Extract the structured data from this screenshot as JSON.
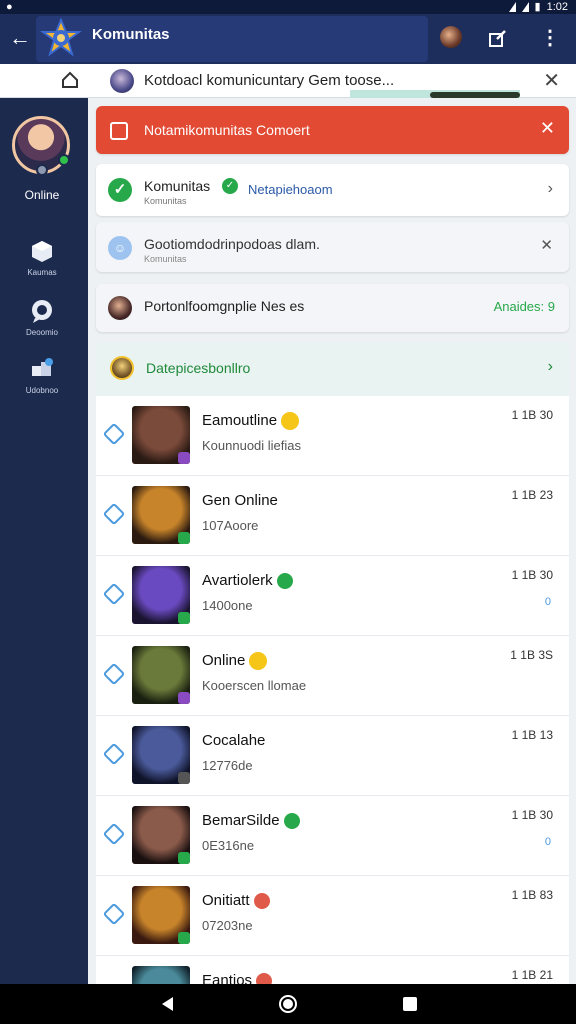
{
  "status_bar": {
    "time": "1:02"
  },
  "app_bar": {
    "title": "Komunitas"
  },
  "search": {
    "text": "Kotdoacl  komunicuntary Gem toose..."
  },
  "sidebar": {
    "online_label": "Online",
    "items": [
      {
        "label": "Kaumas",
        "icon": "box-icon"
      },
      {
        "label": "Deoomio",
        "icon": "chat-bubble-icon"
      },
      {
        "label": "Udobnoo",
        "icon": "group-icon"
      }
    ]
  },
  "alert": {
    "text": "Notamikomunitas Comoert"
  },
  "rows": {
    "row1": {
      "title": "Komunitas",
      "subtitle": "Komunitas",
      "link": "Netapiehoaom"
    },
    "row2": {
      "title": "Gootiomdodrinpodoas dlam.",
      "subtitle": "Komunitas"
    },
    "row3": {
      "title": "Portonlfoomgnplie Nes es",
      "action": "Anaides: 9"
    }
  },
  "section": {
    "title": "Datepicesbonllro"
  },
  "list": [
    {
      "name": "Eamoutline",
      "sub": "Kounnuodi liefias",
      "time": "1 1B 30",
      "tail": "",
      "badge": "emoji",
      "thumb": [
        "#7a4a3a",
        "#2a1a14"
      ],
      "tb": "#8a4ac0"
    },
    {
      "name": "Gen Online",
      "sub": "107Aoore",
      "time": "1 1B 23",
      "tail": "",
      "badge": "",
      "thumb": [
        "#c8842a",
        "#2a1a10"
      ],
      "tb": "#27a84a"
    },
    {
      "name": "Avartiolerk",
      "sub": "1400one",
      "time": "1 1B 30",
      "tail": "0",
      "badge": "green",
      "thumb": [
        "#6a4ac0",
        "#1a1430"
      ],
      "tb": "#27a84a"
    },
    {
      "name": "Online",
      "sub": "Kooerscen llomae",
      "time": "1 1B 3S",
      "tail": "",
      "badge": "emoji",
      "thumb": [
        "#6a7a3a",
        "#1a2010"
      ],
      "tb": "#8a4ac0"
    },
    {
      "name": "Cocalahe",
      "sub": "12776de",
      "time": "1 1B 13",
      "tail": "",
      "badge": "",
      "thumb": [
        "#4a5a9a",
        "#10142a"
      ],
      "tb": "#555555"
    },
    {
      "name": "BemarSilde",
      "sub": "0E316ne",
      "time": "1 1B 30",
      "tail": "0",
      "badge": "green",
      "thumb": [
        "#8a5a4a",
        "#1a1010"
      ],
      "tb": "#27a84a"
    },
    {
      "name": "Onitiatt",
      "sub": "07203ne",
      "time": "1 1B 83",
      "tail": "",
      "badge": "red",
      "thumb": [
        "#c8842a",
        "#3a1a10"
      ],
      "tb": "#27a84a"
    },
    {
      "name": "Eantios",
      "sub": "",
      "time": "1 1B 21",
      "tail": "",
      "badge": "red",
      "thumb": [
        "#4a8a9a",
        "#10202a"
      ],
      "tb": "#27a84a"
    }
  ],
  "colors": {
    "appbar": "#1d2d5c",
    "sidebar": "#1c2a4d",
    "alert": "#e24a33",
    "accent_green": "#27a84a"
  }
}
